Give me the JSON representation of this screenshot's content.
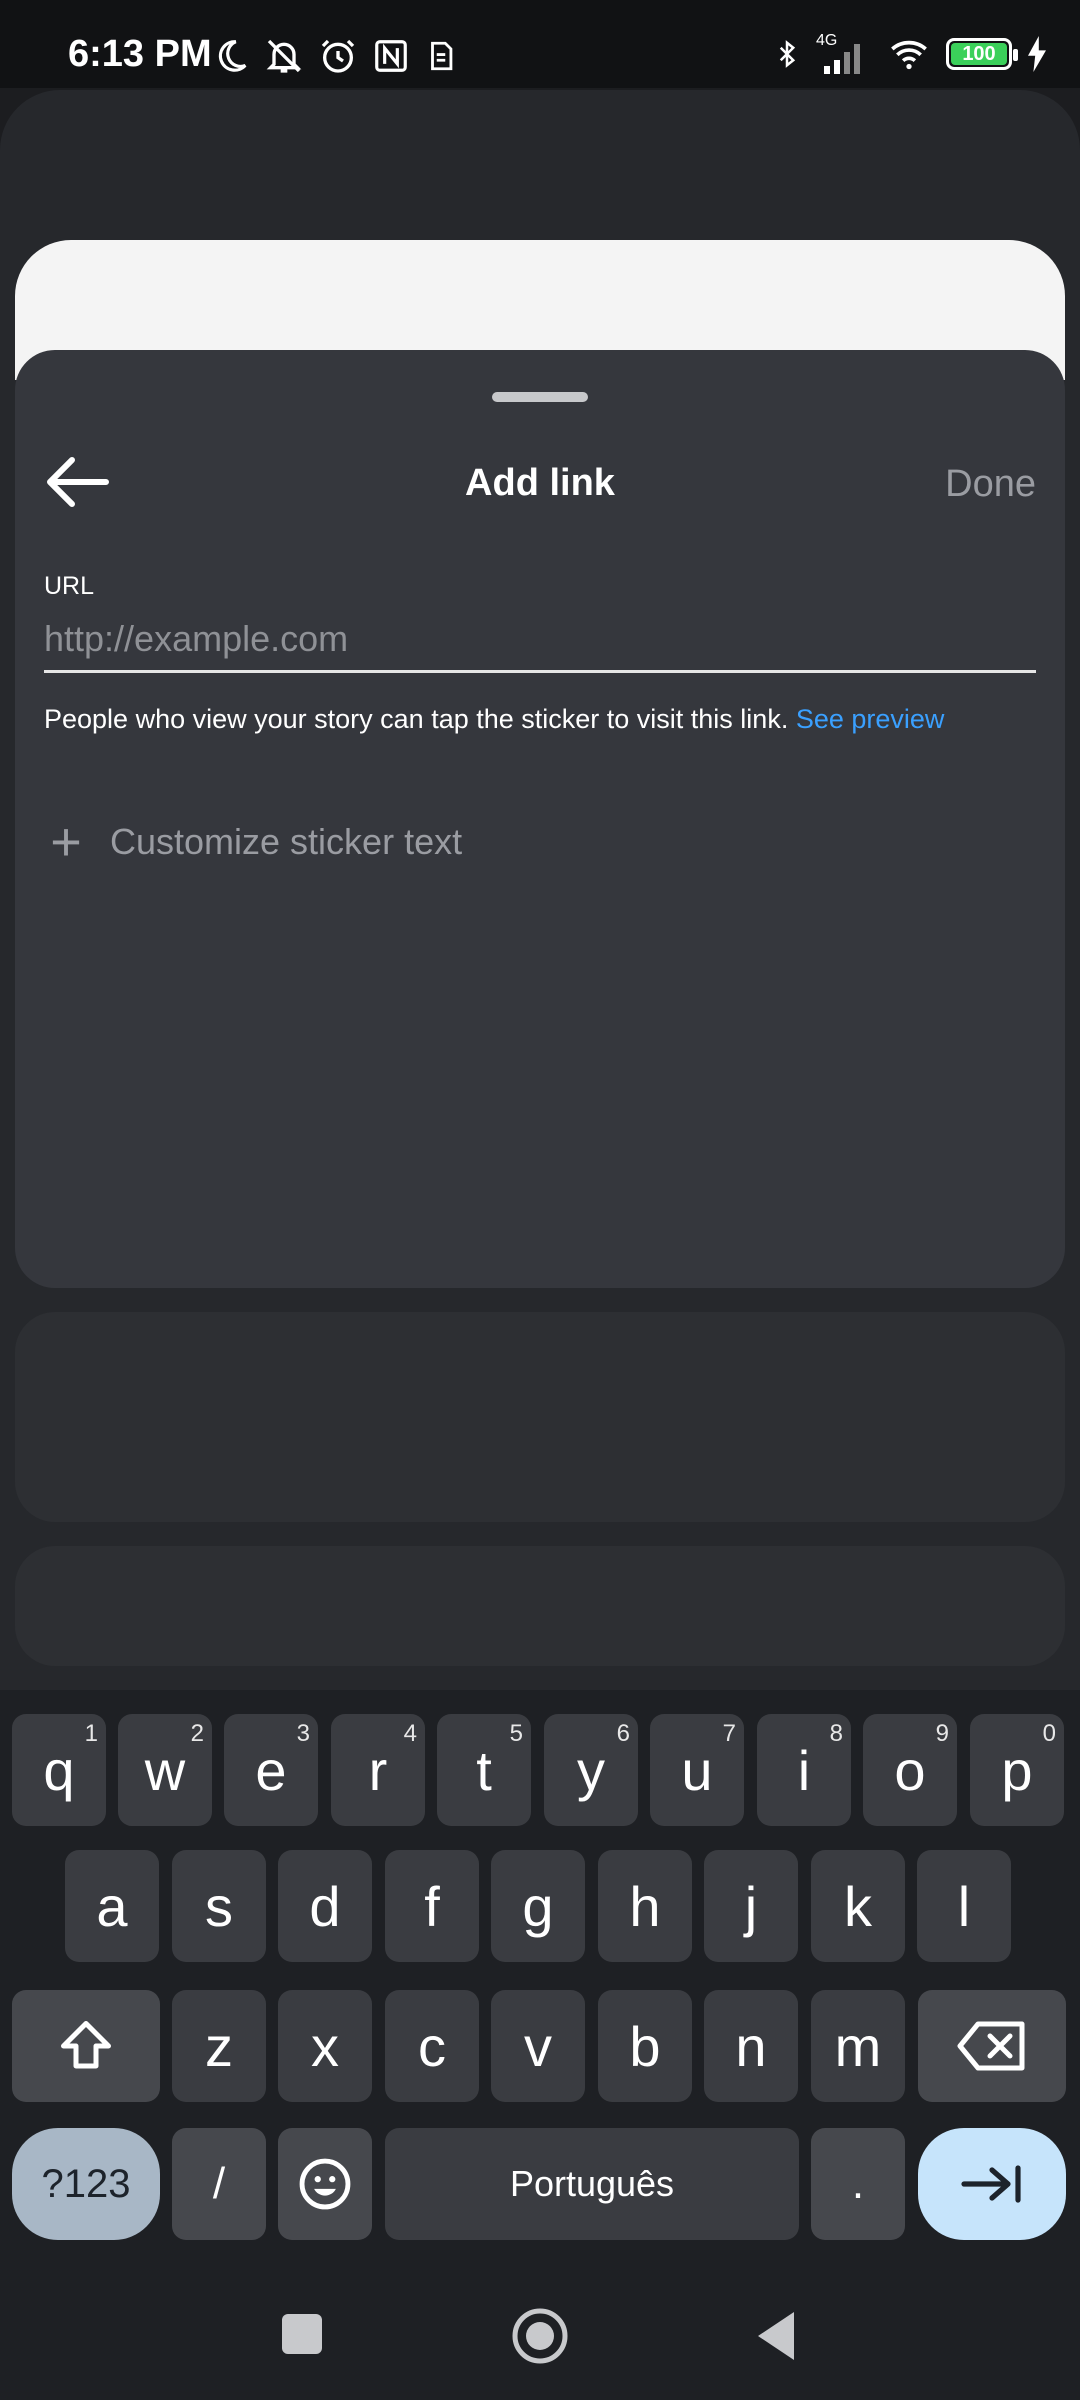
{
  "status_bar": {
    "time": "6:13 PM",
    "network": "4G",
    "battery": "100",
    "icons_left": [
      "moon-icon",
      "bell-off-icon",
      "alarm-icon",
      "nfc-icon",
      "sim-icon"
    ],
    "icons_right": [
      "bluetooth-icon",
      "signal-icon",
      "wifi-icon",
      "battery-icon",
      "charging-icon"
    ]
  },
  "sheet": {
    "title": "Add link",
    "done_label": "Done",
    "url_label": "URL",
    "url_placeholder": "http://example.com",
    "url_value": "",
    "helper_text": "People who view your story can tap the sticker to visit this link.",
    "helper_link": "See preview",
    "customize_label": "Customize sticker text",
    "accent_color": "#3aa0ff"
  },
  "keyboard": {
    "row1": [
      {
        "k": "q",
        "n": "1"
      },
      {
        "k": "w",
        "n": "2"
      },
      {
        "k": "e",
        "n": "3"
      },
      {
        "k": "r",
        "n": "4"
      },
      {
        "k": "t",
        "n": "5"
      },
      {
        "k": "y",
        "n": "6"
      },
      {
        "k": "u",
        "n": "7"
      },
      {
        "k": "i",
        "n": "8"
      },
      {
        "k": "o",
        "n": "9"
      },
      {
        "k": "p",
        "n": "0"
      }
    ],
    "row2": [
      "a",
      "s",
      "d",
      "f",
      "g",
      "h",
      "j",
      "k",
      "l"
    ],
    "row3": [
      "z",
      "x",
      "c",
      "v",
      "b",
      "n",
      "m"
    ],
    "symbols_label": "?123",
    "slash_label": "/",
    "space_label": "Português",
    "period_label": "."
  }
}
